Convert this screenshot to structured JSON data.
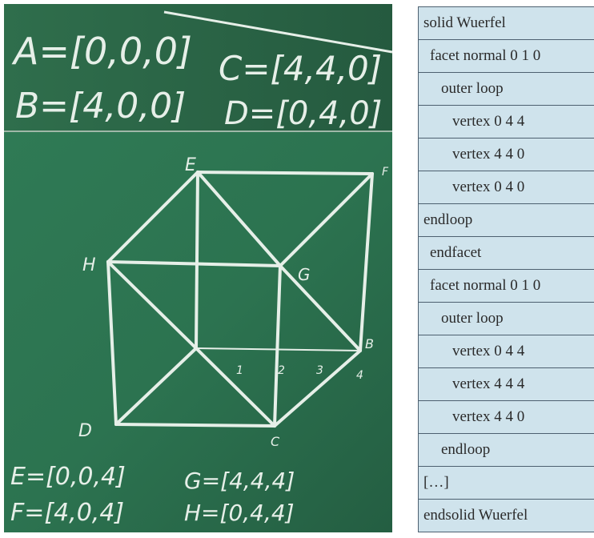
{
  "board": {
    "top_strip": {
      "line_a": "A=[0,0,0]",
      "line_c": "C=[4,4,0]",
      "line_b": "B=[4,0,0]",
      "line_d": "D=[0,4,0]"
    },
    "vertex_labels": {
      "e": "E",
      "f": "F",
      "g": "G",
      "h": "H",
      "b": "B",
      "c": "C",
      "d": "D"
    },
    "axis_ticks": [
      "1",
      "2",
      "3",
      "4"
    ],
    "bottom": {
      "line_e": "E=[0,0,4]",
      "line_f": "F=[4,0,4]",
      "line_g": "G=[4,4,4]",
      "line_h": "H=[0,4,4]"
    },
    "colors": {
      "board": "#2f7a55",
      "top_strip": "#2a6a4a",
      "chalk": "#e6efe8"
    }
  },
  "stl": {
    "rows": [
      {
        "text": "solid Wuerfel",
        "indent": 0
      },
      {
        "text": "facet normal 0 1 0",
        "indent": 1
      },
      {
        "text": "outer loop",
        "indent": 2
      },
      {
        "text": "vertex 0 4 4",
        "indent": 3
      },
      {
        "text": "vertex 4 4 0",
        "indent": 3
      },
      {
        "text": "vertex 0 4 0",
        "indent": 3
      },
      {
        "text": "endloop",
        "indent": 0
      },
      {
        "text": "endfacet",
        "indent": 1
      },
      {
        "text": "facet normal 0 1 0",
        "indent": 1
      },
      {
        "text": "outer loop",
        "indent": 2
      },
      {
        "text": "vertex 0 4 4",
        "indent": 3
      },
      {
        "text": "vertex 4 4 4",
        "indent": 3
      },
      {
        "text": "vertex 4 4 0",
        "indent": 3
      },
      {
        "text": "endloop",
        "indent": 2
      },
      {
        "text": "[…]",
        "indent": 0
      },
      {
        "text": "endsolid Wuerfel",
        "indent": 0
      }
    ],
    "colors": {
      "cell": "#cfe3ec",
      "border": "#4d6070"
    }
  }
}
